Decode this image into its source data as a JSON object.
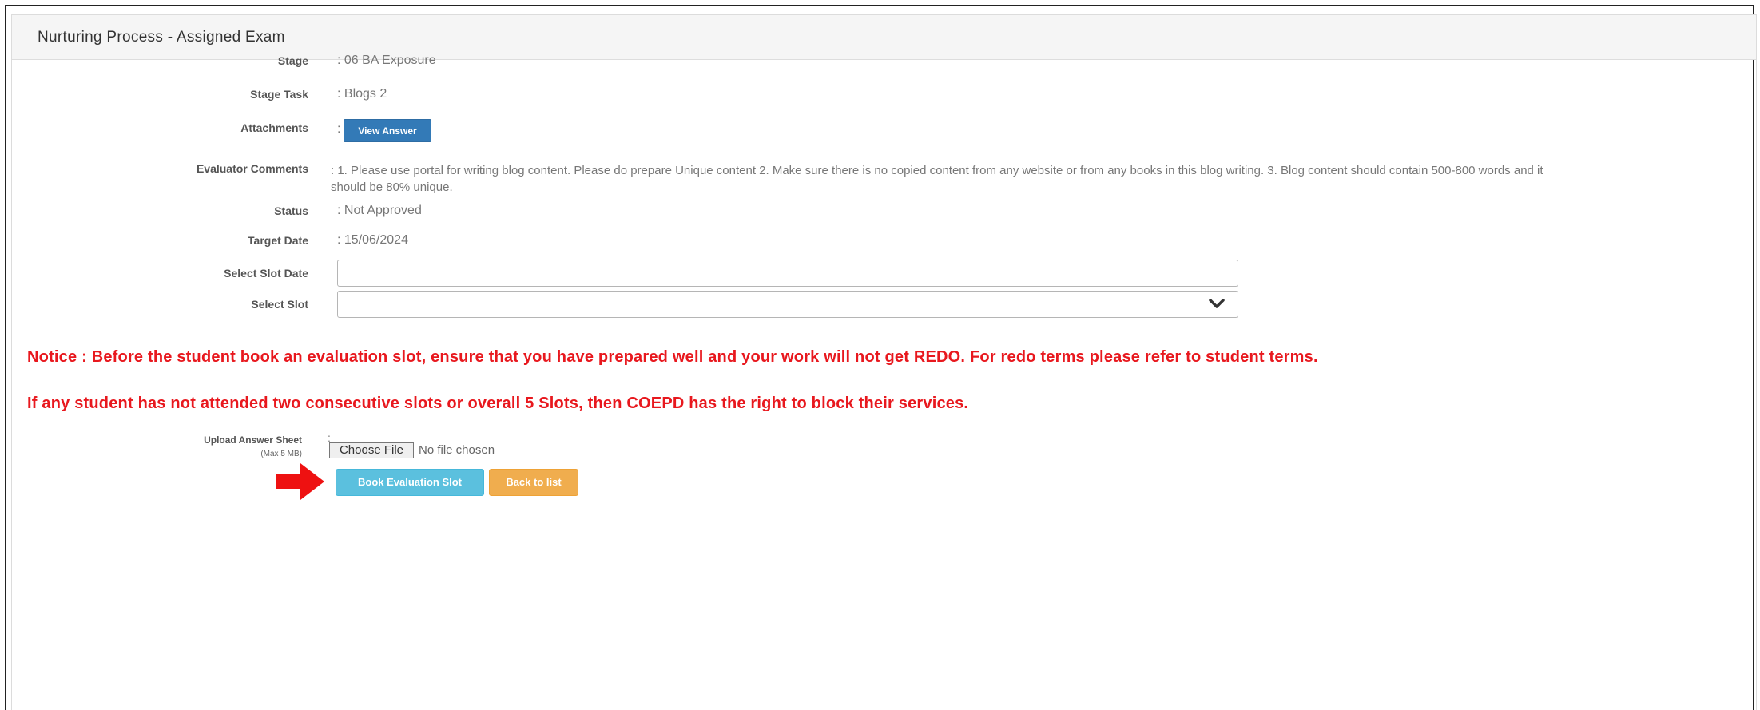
{
  "panel": {
    "title": "Nurturing Process - Assigned Exam"
  },
  "details": {
    "stage": {
      "label": "Stage",
      "value": ": 06 BA Exposure"
    },
    "stage_task": {
      "label": "Stage Task",
      "value": ": Blogs 2"
    },
    "attachments": {
      "label": "Attachments",
      "colon": ":",
      "button": "View Answer"
    },
    "evaluator_comments": {
      "label": "Evaluator Comments",
      "value": ": 1. Please use portal for writing blog content. Please do prepare Unique content 2. Make sure there is no copied content from any website or from any books in this blog writing. 3. Blog content should contain 500-800 words and it should be 80% unique."
    },
    "status": {
      "label": "Status",
      "value": ": Not Approved"
    },
    "target_date": {
      "label": "Target Date",
      "value": ": 15/06/2024"
    }
  },
  "form": {
    "slot_date": {
      "label": "Select Slot Date",
      "value": ""
    },
    "slot": {
      "label": "Select Slot",
      "value": ""
    }
  },
  "notices": {
    "line1": "Notice : Before the student book an evaluation slot, ensure that you have prepared well and your work will not get REDO. For redo terms please refer to student terms.",
    "line2": "If any student has not attended two consecutive slots or overall 5 Slots, then COEPD has the right to block their services."
  },
  "upload": {
    "label": "Upload Answer Sheet",
    "sublabel": "(Max 5 MB)",
    "colon": ":",
    "choose_button": "Choose File",
    "status": "No file chosen"
  },
  "actions": {
    "book": "Book Evaluation Slot",
    "back": "Back to list"
  },
  "colors": {
    "notice_red": "#e8181e",
    "primary": "#337ab7",
    "info": "#5bc0de",
    "warning": "#f0ad4e",
    "annotation_arrow": "#ee1111"
  },
  "icons": {
    "select_caret": "chevron-down-icon",
    "pointer": "arrow-right-icon"
  }
}
